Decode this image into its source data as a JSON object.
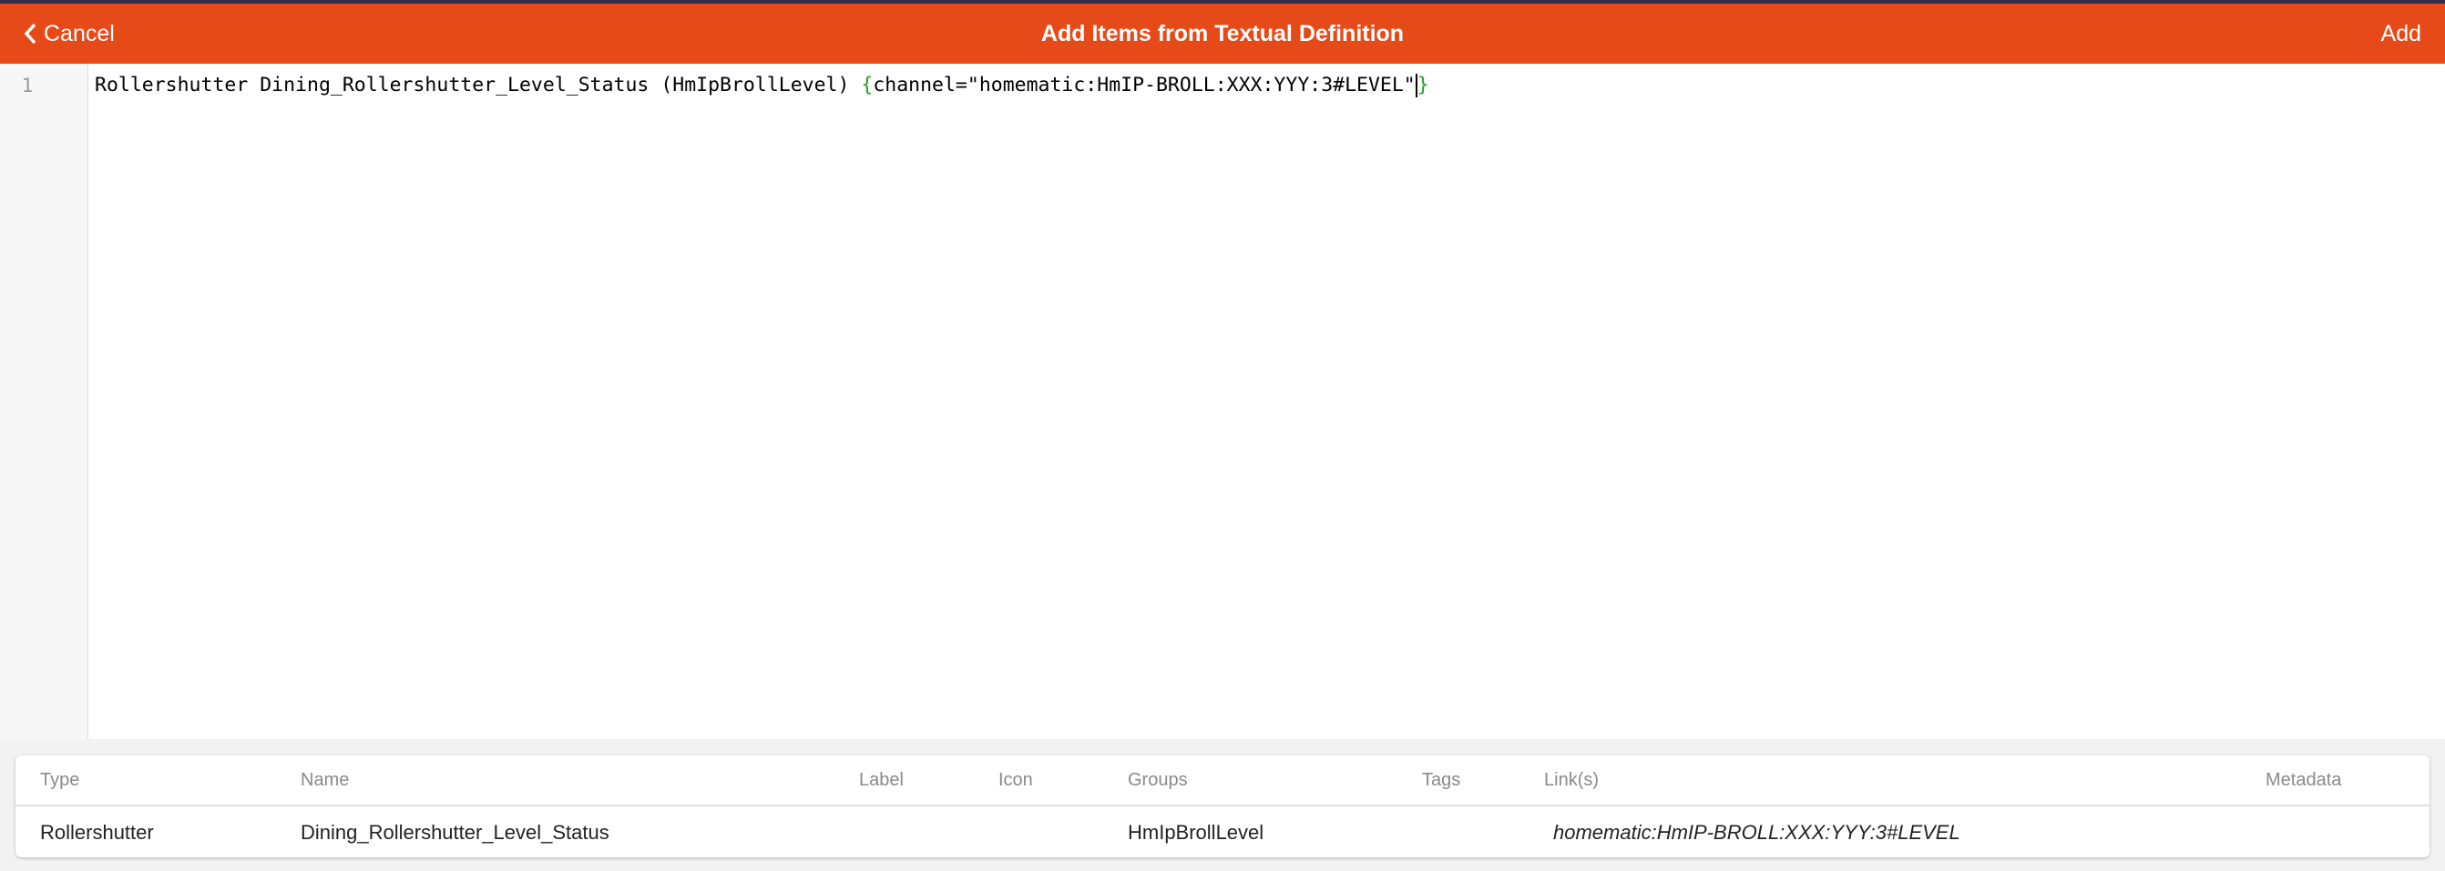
{
  "nav": {
    "cancel": "Cancel",
    "title": "Add Items from Textual Definition",
    "add": "Add"
  },
  "editor": {
    "line_number": "1",
    "code_main": "Rollershutter Dining_Rollershutter_Level_Status (HmIpBrollLevel) ",
    "brace_open": "{",
    "code_channel": "channel=\"homematic:HmIP-BROLL:XXX:YYY:3#LEVEL\"",
    "brace_close": "}"
  },
  "table": {
    "headers": {
      "type": "Type",
      "name": "Name",
      "label": "Label",
      "icon": "Icon",
      "groups": "Groups",
      "tags": "Tags",
      "links": "Link(s)",
      "metadata": "Metadata"
    },
    "rows": [
      {
        "type": "Rollershutter",
        "name": "Dining_Rollershutter_Level_Status",
        "label": "",
        "icon": "",
        "groups": "HmIpBrollLevel",
        "tags": "",
        "links": "homematic:HmIP-BROLL:XXX:YYY:3#LEVEL",
        "metadata": ""
      }
    ]
  },
  "colors": {
    "accent": "#e64a19"
  }
}
